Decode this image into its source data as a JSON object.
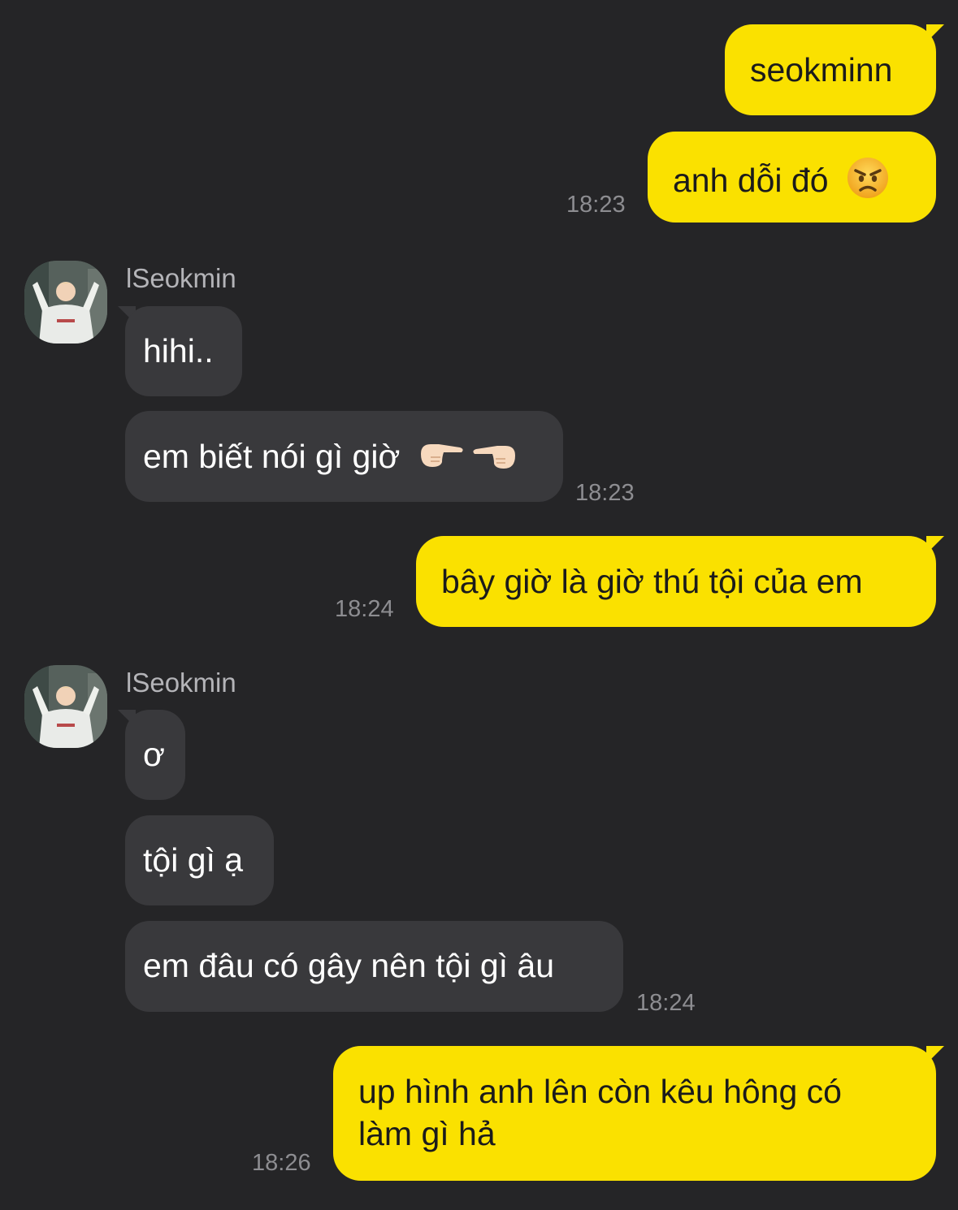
{
  "sender_name": "lSeokmin",
  "messages": {
    "m1": "seokminn",
    "m2": "anh dỗi đó",
    "m2_time": "18:23",
    "m3": "hihi..",
    "m4": "em biết nói gì giờ",
    "m4_time": "18:23",
    "m5": "bây giờ là giờ thú tội của em",
    "m5_time": "18:24",
    "m6": "ơ",
    "m7": "tội gì ạ",
    "m8": "em đâu có gây nên tội gì âu",
    "m8_time": "18:24",
    "m9_line1": "up hình anh lên còn kêu hông có",
    "m9_line2": "làm gì hả",
    "m9_time": "18:26"
  },
  "emoji": {
    "m2": "angry-face-icon",
    "m4": "pointing-fingers-icon"
  },
  "colors": {
    "background": "#252527",
    "outgoing_bubble": "#fae100",
    "incoming_bubble": "#39393c",
    "timestamp": "#8d8d91"
  }
}
